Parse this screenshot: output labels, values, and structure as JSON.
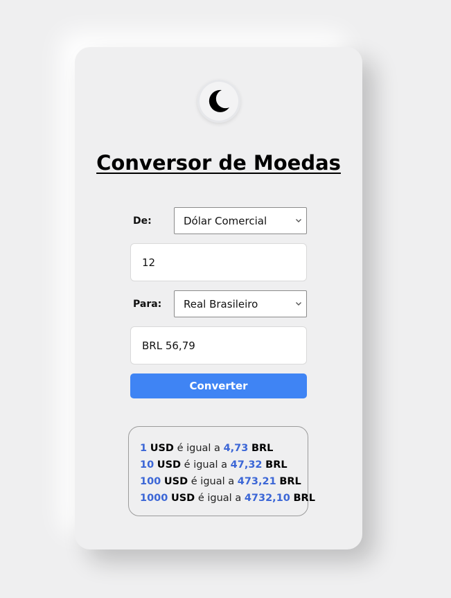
{
  "title": "Conversor de Moedas",
  "theme_toggle": {
    "icon": "moon-icon"
  },
  "from": {
    "label": "De:",
    "selected": "Dólar Comercial",
    "amount": "12"
  },
  "to": {
    "label": "Para:",
    "selected": "Real Brasileiro",
    "result": "BRL 56,79"
  },
  "convert_button": "Converter",
  "rates": [
    {
      "amount": "1",
      "from": "USD",
      "text": "é igual a",
      "value": "4,73",
      "to": "BRL"
    },
    {
      "amount": "10",
      "from": "USD",
      "text": "é igual a",
      "value": "47,32",
      "to": "BRL"
    },
    {
      "amount": "100",
      "from": "USD",
      "text": "é igual a",
      "value": "473,21",
      "to": "BRL"
    },
    {
      "amount": "1000",
      "from": "USD",
      "text": "é igual a",
      "value": "4732,10",
      "to": "BRL"
    }
  ],
  "colors": {
    "accent": "#3f84f4",
    "number": "#3b66d6",
    "background": "#efeff0"
  }
}
